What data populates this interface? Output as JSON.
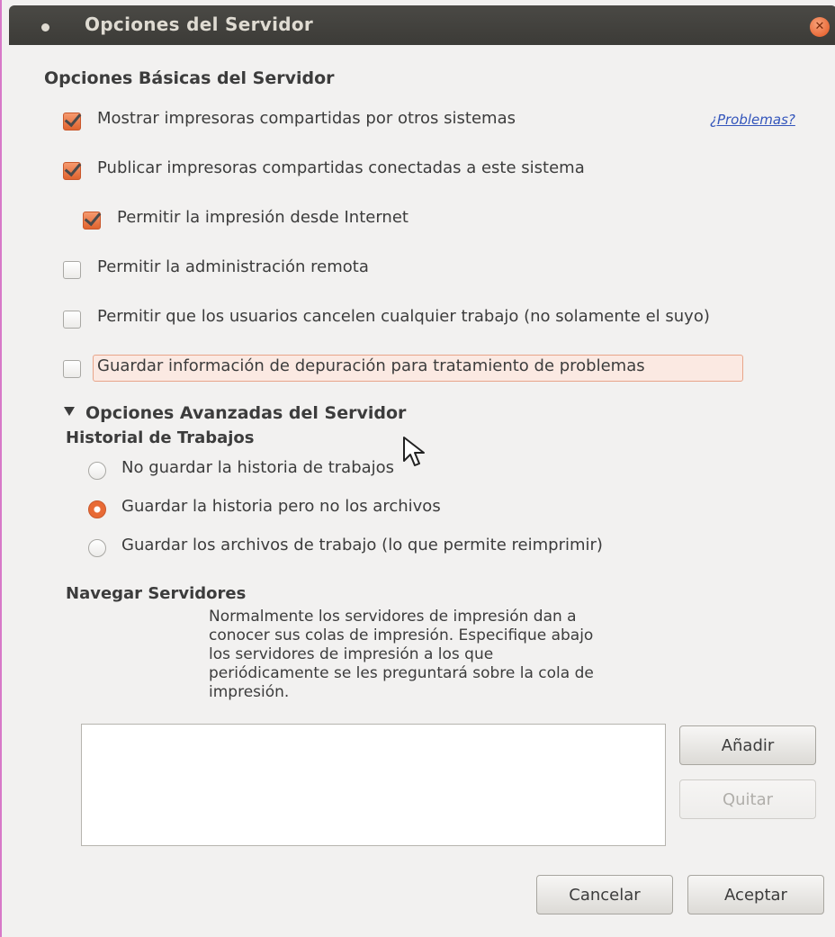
{
  "window": {
    "title": "Opciones del Servidor",
    "accent_color": "#e86a35",
    "titlebar_color": "#3c3b37"
  },
  "basic": {
    "heading": "Opciones Básicas del Servidor",
    "problems_link": "¿Problemas?",
    "options": [
      {
        "label": "Mostrar impresoras compartidas por otros sistemas",
        "checked": true
      },
      {
        "label": "Publicar impresoras compartidas conectadas a este sistema",
        "checked": true
      },
      {
        "label": "Permitir la impresión desde Internet",
        "checked": true
      },
      {
        "label": "Permitir la administración remota",
        "checked": false
      },
      {
        "label": "Permitir que los usuarios cancelen cualquier trabajo (no solamente el suyo)",
        "checked": false
      },
      {
        "label": "Guardar información de depuración para tratamiento de problemas",
        "checked": false
      }
    ]
  },
  "advanced": {
    "heading": "Opciones Avanzadas del Servidor",
    "expanded": true,
    "job_history": {
      "heading": "Historial de Trabajos",
      "options": [
        {
          "label": "No guardar la historia de trabajos",
          "selected": false
        },
        {
          "label": "Guardar la historia pero no los archivos",
          "selected": true
        },
        {
          "label": "Guardar los archivos de trabajo (lo que permite reimprimir)",
          "selected": false
        }
      ]
    },
    "browse": {
      "heading": "Navegar Servidores",
      "description_lines": [
        "Normalmente los servidores de impresión dan a",
        "conocer sus colas de impresión. Especifique abajo",
        "los servidores de impresión a los que",
        "periódicamente se les preguntará sobre la cola de",
        "impresión."
      ],
      "servers": [],
      "add_label": "Añadir",
      "remove_label": "Quitar"
    }
  },
  "footer": {
    "cancel_label": "Cancelar",
    "ok_label": "Aceptar"
  }
}
